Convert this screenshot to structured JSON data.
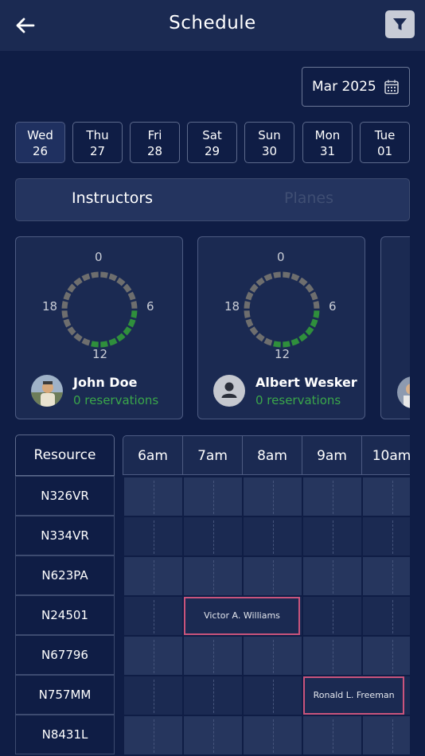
{
  "header": {
    "title": "Schedule",
    "back_icon": "arrow-left-icon",
    "filter_icon": "funnel-icon"
  },
  "month_picker": {
    "label": "Mar 2025",
    "icon": "calendar-icon"
  },
  "days": [
    {
      "name": "Wed",
      "date": "26",
      "selected": true
    },
    {
      "name": "Thu",
      "date": "27"
    },
    {
      "name": "Fri",
      "date": "28"
    },
    {
      "name": "Sat",
      "date": "29"
    },
    {
      "name": "Sun",
      "date": "30"
    },
    {
      "name": "Mon",
      "date": "31"
    },
    {
      "name": "Tue",
      "date": "01"
    }
  ],
  "tabs": {
    "instructors": "Instructors",
    "planes": "Planes",
    "active": "instructors"
  },
  "instructors": [
    {
      "name": "John Doe",
      "reservations": "0 reservations",
      "avatar": "photo",
      "ring_labels": {
        "top": "0",
        "right": "6",
        "bottom": "12",
        "left": "18"
      }
    },
    {
      "name": "Albert Wesker",
      "reservations": "0 reservations",
      "avatar": "person-icon",
      "ring_labels": {
        "top": "0",
        "right": "6",
        "bottom": "12",
        "left": "18"
      }
    }
  ],
  "ring": {
    "segments": 24,
    "available_from": 6,
    "available_to": 13,
    "available_color": "#2f8f3c",
    "busy_color": "#6e6e6e"
  },
  "grid": {
    "resource_header": "Resource",
    "hours": [
      "6am",
      "7am",
      "8am",
      "9am",
      "10am"
    ],
    "resources": [
      "N326VR",
      "N334VR",
      "N623PA",
      "N24501",
      "N67796",
      "N757MM",
      "N8431L"
    ],
    "bookings": [
      {
        "resource_index": 3,
        "start": 7,
        "end": 9,
        "label": "Victor A. Williams"
      },
      {
        "resource_index": 5,
        "start": 9,
        "end": 10.75,
        "label": "Ronald L. Freeman"
      }
    ],
    "booking_border_color": "#c9547c"
  }
}
